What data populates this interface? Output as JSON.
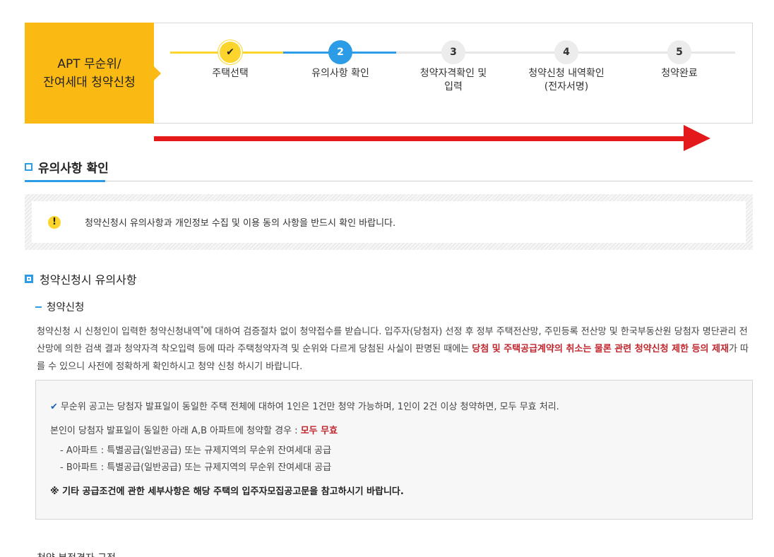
{
  "stepper": {
    "badge_line1": "APT 무순위/",
    "badge_line2": "잔여세대 청약신청",
    "steps": [
      {
        "number": "✔",
        "label1": "주택선택",
        "label2": "",
        "status": "done"
      },
      {
        "number": "2",
        "label1": "유의사항 확인",
        "label2": "",
        "status": "active"
      },
      {
        "number": "3",
        "label1": "청약자격확인 및",
        "label2": "입력",
        "status": "todo"
      },
      {
        "number": "4",
        "label1": "청약신청 내역확인",
        "label2": "(전자서명)",
        "status": "todo"
      },
      {
        "number": "5",
        "label1": "청약완료",
        "label2": "",
        "status": "todo"
      }
    ],
    "colors": {
      "done": "#fbd52c",
      "active": "#2d9ce6",
      "todo": "#ececec"
    }
  },
  "section": {
    "title": "유의사항 확인",
    "notice": "청약신청시 유의사항과 개인정보 수집 및 이용 동의 사항을 반드시 확인 바랍니다."
  },
  "subsection": {
    "title": "청약신청시 유의사항",
    "bullet": "청약신청",
    "para_a": "청약신청 시 신청인이 입력한 청약신청내역",
    "para_sup": "*",
    "para_b": "에 대하여 검증절차 없이 청약접수를 받습니다. 입주자(당첨자) 선정 후 정부 주택전산망, 주민등록 전산망 및 한국부동산원 당첨자 명단관리 전산망에 의한 검색 결과 청약자격 착오입력 등에 따라 주택청약자격 및 순위와 다르게 당첨된 사실이 판명된 때에는 ",
    "para_highlight": "당첨 및 주택공급계약의 취소는 물론 관련 청약신청 제한 등의 제재",
    "para_c": "가 따를 수 있으니 사전에 정확하게 확인하시고 청약 신청 하시기 바랍니다."
  },
  "info": {
    "line1": "무순위 공고는 당첨자 발표일이 동일한 주택 전체에 대하여 1인은 1건만 청약 가능하며, 1인이 2건 이상 청약하면, 모두 무효 처리.",
    "line2": "본인이 당첨자 발표일이 동일한 아래 A,B 아파트에 청약할 경우 : ",
    "line2_highlight": "모두 무효",
    "item_a": "-  A아파트 : 특별공급(일반공급) 또는 규제지역의 무순위 잔여세대 공급",
    "item_b": "-  B아파트 : 특별공급(일반공급) 또는 규제지역의 무순위 잔여세대 공급",
    "note": "※ 기타 공급조건에 관한 세부사항은 해당 주택의 입주자모집공고문을 참고하시기 바랍니다."
  },
  "cut_text": "청약 부적격자 규정"
}
